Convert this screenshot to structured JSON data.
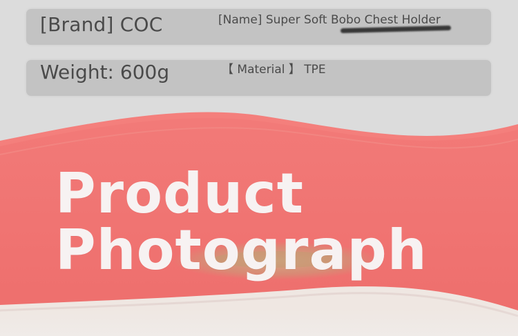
{
  "colors": {
    "page_bg": "#dcdcdc",
    "bar_bg": "#c3c3c3",
    "text_gray": "#4a4a4a",
    "coral": "#f27a78",
    "coral_dark": "#e96664",
    "title_text": "#f7f2f2"
  },
  "header": {
    "brand_text": "[Brand] COC",
    "name_text": "[Name] Super Soft Bobo Chest Holder",
    "weight_text": "Weight: 600g",
    "material_text": "【 Material 】 TPE"
  },
  "hero": {
    "line1": "Product",
    "line2": "Photograph"
  }
}
